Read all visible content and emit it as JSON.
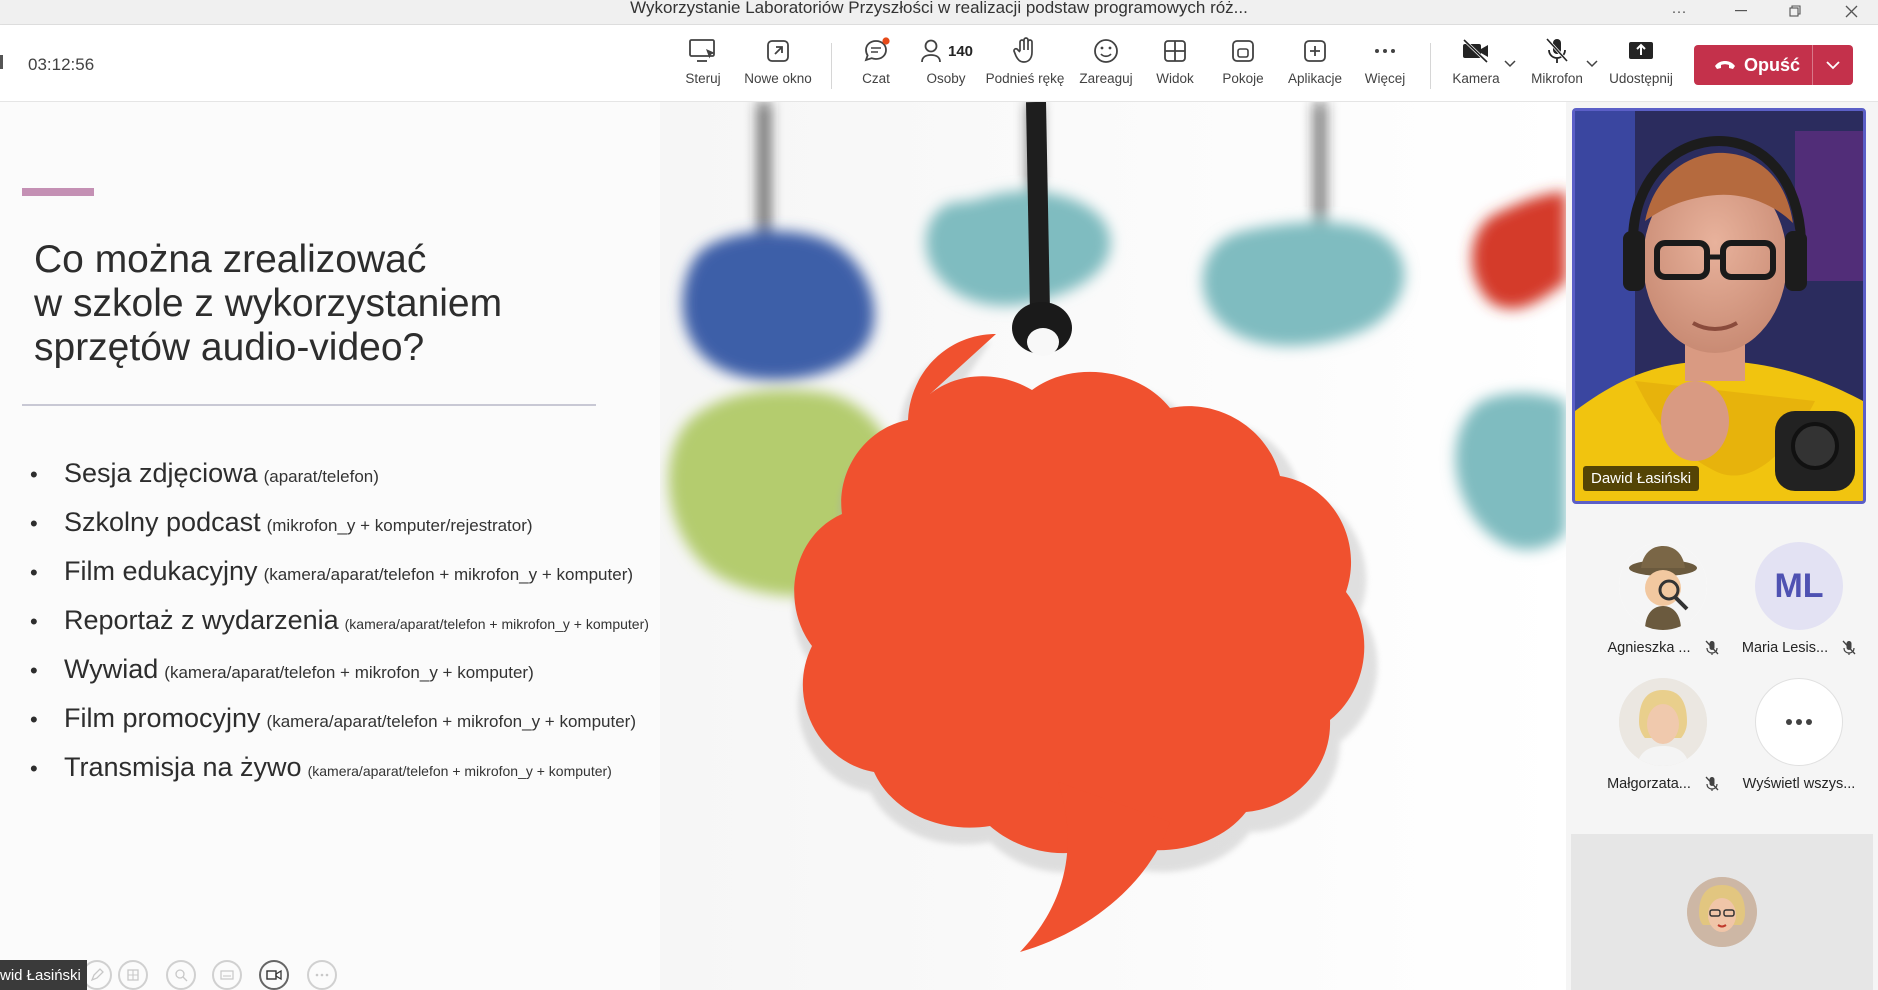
{
  "window": {
    "title": "Wykorzystanie Laboratoriów Przyszłości w realizacji podstaw programowych róż...",
    "controls": [
      "more-icon",
      "minimize-icon",
      "restore-icon",
      "close-icon"
    ]
  },
  "toolbar": {
    "timer": "03:12:56",
    "buttons": {
      "control": "Steruj",
      "new_window": "Nowe okno",
      "chat": "Czat",
      "people": "Osoby",
      "people_count": "140",
      "raise_hand": "Podnieś rękę",
      "react": "Zareaguj",
      "view": "Widok",
      "rooms": "Pokoje",
      "apps": "Aplikacje",
      "more": "Więcej",
      "camera": "Kamera",
      "mic": "Mikrofon",
      "share": "Udostępnij"
    },
    "leave_label": "Opuść",
    "colors": {
      "leave": "#c4314b",
      "chat_badge": "#e64a19",
      "accent": "#5b5fc7"
    }
  },
  "slide": {
    "title": "Co można zrealizować w szkole z wykorzystaniem sprzętów audio-video?",
    "title_lines": [
      "Co można zrealizować",
      "w szkole z wykorzystaniem",
      "sprzętów audio-video?"
    ],
    "bullets": [
      {
        "main": "Sesja zdjęciowa",
        "note": "(aparat/telefon)"
      },
      {
        "main": "Szkolny podcast",
        "note": "(mikrofon_y + komputer/rejestrator)"
      },
      {
        "main": "Film edukacyjny",
        "note": "(kamera/aparat/telefon + mikrofon_y + komputer)"
      },
      {
        "main": "Reportaż z wydarzenia",
        "note": "(kamera/aparat/telefon + mikrofon_y + komputer)"
      },
      {
        "main": "Wywiad",
        "note": "(kamera/aparat/telefon + mikrofon_y + komputer)"
      },
      {
        "main": "Film promocyjny",
        "note": "(kamera/aparat/telefon + mikrofon_y + komputer)"
      },
      {
        "main": "Transmisja na żywo",
        "note": "(kamera/aparat/telefon + mikrofon_y + komputer)"
      }
    ],
    "presenter_tag": "wid Łasiński",
    "colors": {
      "accent_bar": "#c490b4",
      "cloud_main": "#f0512f",
      "cloud_teal": "#7fbcc0",
      "cloud_green": "#b4cc6e",
      "cloud_blue": "#3e5ea8"
    }
  },
  "panel": {
    "speaker": {
      "name": "Dawid Łasiński"
    },
    "participants": [
      {
        "name": "Agnieszka ...",
        "muted": true
      },
      {
        "name": "Maria Lesis...",
        "initials": "ML",
        "muted": true
      },
      {
        "name": "Małgorzata...",
        "muted": true
      },
      {
        "name": "Wyświetl wszys..."
      }
    ]
  }
}
